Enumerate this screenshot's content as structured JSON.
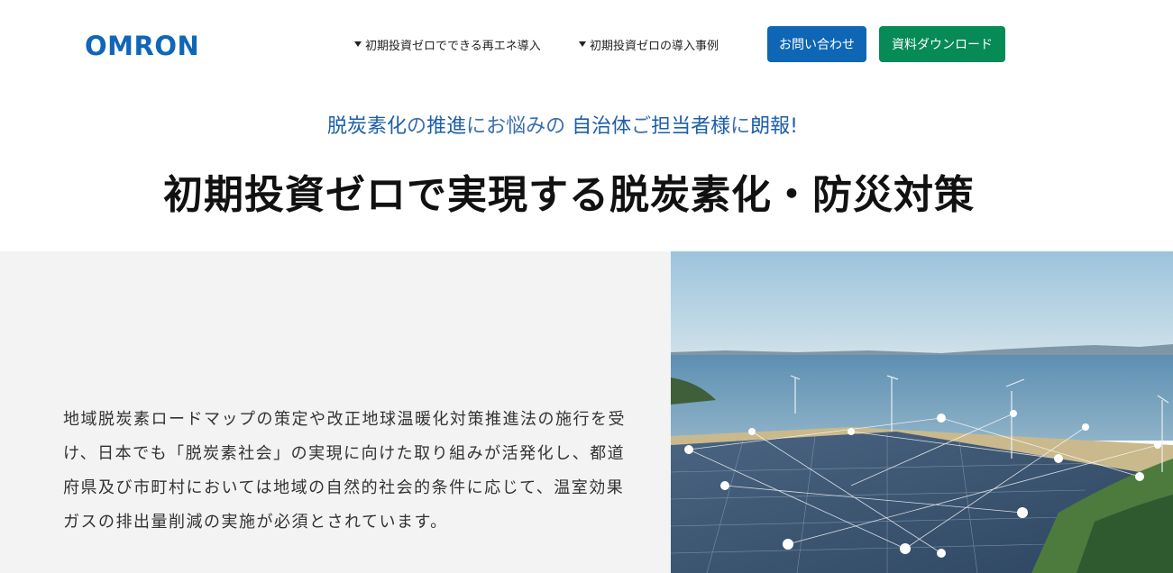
{
  "header": {
    "logo": "OMRON",
    "nav": [
      {
        "label": "初期投資ゼロでできる再エネ導入"
      },
      {
        "label": "初期投資ゼロの導入事例"
      }
    ],
    "buttons": {
      "contact": "お問い合わせ",
      "download": "資料ダウンロード"
    }
  },
  "hero": {
    "lead_part1": "脱炭素化",
    "lead_part2": "の",
    "lead_part3": "推進",
    "lead_part4": "にお悩みの ",
    "lead_part5": "自治体",
    "lead_part6": "ご",
    "lead_part7": "担当者様",
    "lead_part8": "に",
    "lead_part9": "朗報!",
    "title": "初期投資ゼロで実現する脱炭素化・防災対策"
  },
  "intro": {
    "lines": [
      "地域脱炭素ロードマップの策定や改正地球温暖化対策推進法の施行を受",
      "け、日本でも「脱炭素社会」の実現に向けた取り組みが活発化し、都道",
      "府県及び市町村においては地域の自然的社会的条件に応じて、温室効果",
      "ガスの排出量削減の実施が必須とされています。"
    ]
  },
  "colors": {
    "brand_blue": "#1066b7",
    "contact_button": "#0e66b5",
    "download_button": "#068a56",
    "lead_text": "#3b6fb0"
  },
  "icons": {
    "nav_marker": "caret-down-icon"
  }
}
